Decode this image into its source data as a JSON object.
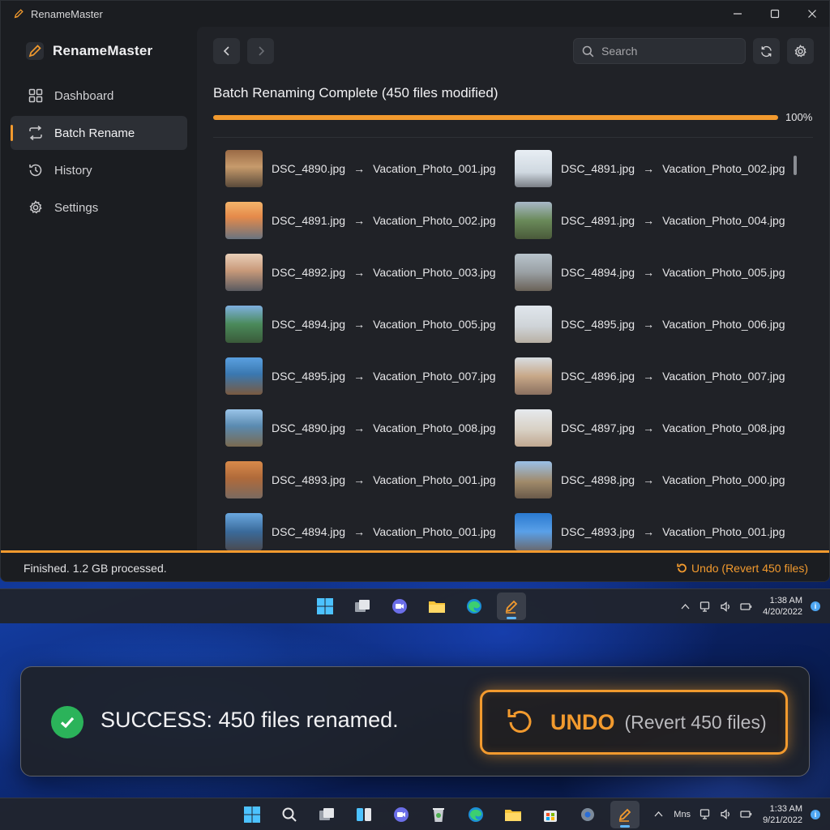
{
  "window": {
    "title": "RenameMaster"
  },
  "sidebar": {
    "brand": "RenameMaster",
    "items": [
      {
        "label": "Dashboard",
        "icon": "grid-icon",
        "active": false
      },
      {
        "label": "Batch Rename",
        "icon": "swap-icon",
        "active": true
      },
      {
        "label": "History",
        "icon": "history-icon",
        "active": false
      },
      {
        "label": "Settings",
        "icon": "gear-icon",
        "active": false
      }
    ]
  },
  "toolbar": {
    "search_placeholder": "Search"
  },
  "main": {
    "heading": "Batch Renaming Complete (450 files modified)",
    "progress": {
      "value_percent": 100,
      "label": "100%"
    }
  },
  "files": [
    {
      "from": "DSC_4890.jpg",
      "to": "Vacation_Photo_001.jpg"
    },
    {
      "from": "DSC_4891.jpg",
      "to": "Vacation_Photo_002.jpg"
    },
    {
      "from": "DSC_4891.jpg",
      "to": "Vacation_Photo_002.jpg"
    },
    {
      "from": "DSC_4891.jpg",
      "to": "Vacation_Photo_004.jpg"
    },
    {
      "from": "DSC_4892.jpg",
      "to": "Vacation_Photo_003.jpg"
    },
    {
      "from": "DSC_4894.jpg",
      "to": "Vacation_Photo_005.jpg"
    },
    {
      "from": "DSC_4894.jpg",
      "to": "Vacation_Photo_005.jpg"
    },
    {
      "from": "DSC_4895.jpg",
      "to": "Vacation_Photo_006.jpg"
    },
    {
      "from": "DSC_4895.jpg",
      "to": "Vacation_Photo_007.jpg"
    },
    {
      "from": "DSC_4896.jpg",
      "to": "Vacation_Photo_007.jpg"
    },
    {
      "from": "DSC_4890.jpg",
      "to": "Vacation_Photo_008.jpg"
    },
    {
      "from": "DSC_4897.jpg",
      "to": "Vacation_Photo_008.jpg"
    },
    {
      "from": "DSC_4893.jpg",
      "to": "Vacation_Photo_001.jpg"
    },
    {
      "from": "DSC_4898.jpg",
      "to": "Vacation_Photo_000.jpg"
    },
    {
      "from": "DSC_4894.jpg",
      "to": "Vacation_Photo_001.jpg"
    },
    {
      "from": "DSC_4893.jpg",
      "to": "Vacation_Photo_001.jpg"
    }
  ],
  "statusbar": {
    "text": "Finished. 1.2 GB processed.",
    "undo_label": "Undo (Revert 450 files)"
  },
  "taskbar_top": {
    "time": "1:38 AM",
    "date": "4/20/2022"
  },
  "toast": {
    "message": "SUCCESS: 450 files renamed.",
    "undo_label": "UNDO",
    "undo_sub": "(Revert 450 files)"
  },
  "taskbar_bottom": {
    "lang": "Mns",
    "time": "1:33 AM",
    "date": "9/21/2022"
  },
  "colors": {
    "accent": "#f29a2e",
    "success": "#2bb35a",
    "taskbar_indicator": "#5fb8ff"
  }
}
